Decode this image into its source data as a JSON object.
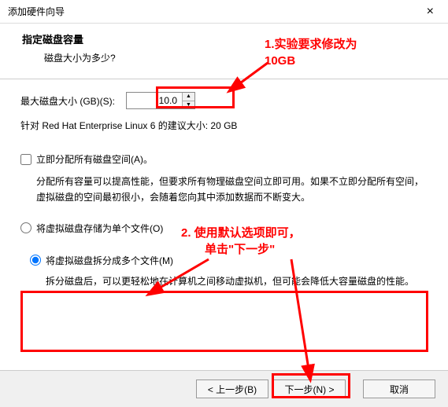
{
  "window": {
    "title": "添加硬件向导"
  },
  "header": {
    "title": "指定磁盘容量",
    "subtitle": "磁盘大小为多少?"
  },
  "disk": {
    "label": "最大磁盘大小 (GB)(S):",
    "value": "10.0",
    "recommend": "针对 Red Hat Enterprise Linux 6 的建议大小: 20 GB"
  },
  "allocate": {
    "label": "立即分配所有磁盘空间(A)。",
    "desc": "分配所有容量可以提高性能，但要求所有物理磁盘空间立即可用。如果不立即分配所有空间，虚拟磁盘的空间最初很小，会随着您向其中添加数据而不断变大。"
  },
  "storage": {
    "single": "将虚拟磁盘存储为单个文件(O)",
    "split": "将虚拟磁盘拆分成多个文件(M)",
    "split_desc": "拆分磁盘后，可以更轻松地在计算机之间移动虚拟机，但可能会降低大容量磁盘的性能。"
  },
  "buttons": {
    "back": "< 上一步(B)",
    "next": "下一步(N) >",
    "cancel": "取消"
  },
  "annotations": {
    "note1_l1": "1.实验要求修改为",
    "note1_l2": "10GB",
    "note2_l1": "2. 使用默认选项即可，",
    "note2_l2": "单击\"下一步\""
  }
}
